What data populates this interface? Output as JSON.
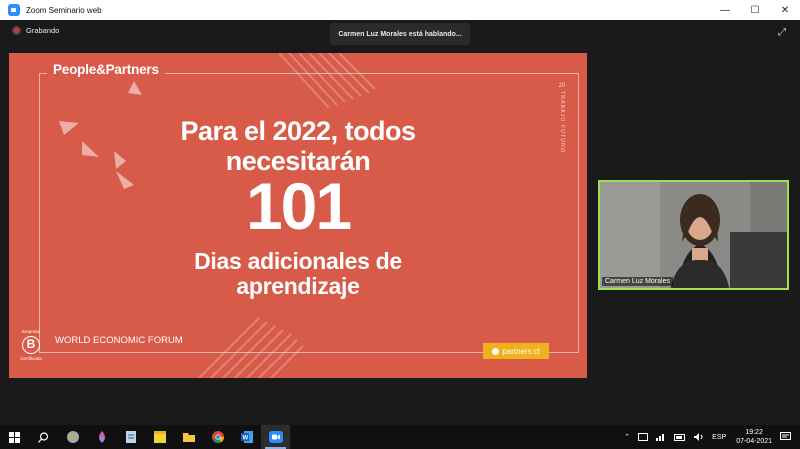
{
  "window": {
    "title": "Zoom Seminario web",
    "minimize_glyph": "—",
    "maximize_glyph": "☐",
    "close_glyph": "✕"
  },
  "meeting": {
    "recording_label": "Grabando",
    "speaking_label": "Carmen Luz Morales está hablando...",
    "expand_glyph": "⤢"
  },
  "slide": {
    "logo": "People&Partners",
    "side_number": "20",
    "side_text": "TRABAJO FUTURO",
    "headline_line1": "Para el 2022, todos",
    "headline_line2": "necesitarán",
    "big_number": "101",
    "sub_line1": "Dias adicionales de",
    "sub_line2": "aprendizaje",
    "source": "WORLD ECONOMIC FORUM",
    "bcorp_top": "Empresa",
    "bcorp_letter": "B",
    "bcorp_bottom": "Certificada",
    "website": "partners.cl"
  },
  "video": {
    "participant_name": "Carmen Luz Morales"
  },
  "taskbar": {
    "apps": [
      "start-icon",
      "search-icon",
      "photos-icon",
      "paint-icon",
      "notepad-icon",
      "sticky-notes-icon",
      "file-explorer-icon",
      "chrome-icon",
      "word-icon",
      "zoom-icon"
    ],
    "language": "ESP",
    "time": "19:22",
    "date": "07-04-2021"
  },
  "colors": {
    "slide_bg": "#d85a48",
    "accent_yellow": "#f0b11c",
    "video_border": "#9be04d",
    "zoom_blue": "#2d8cff"
  }
}
